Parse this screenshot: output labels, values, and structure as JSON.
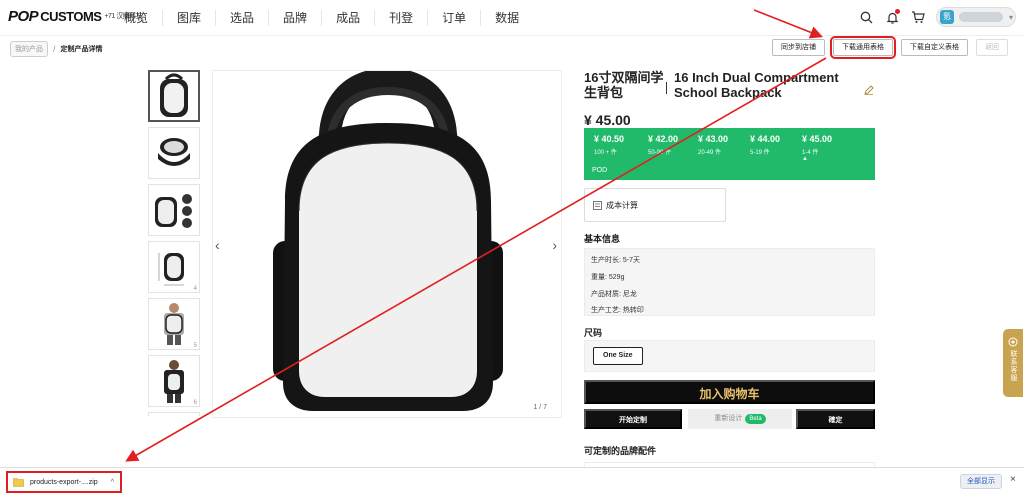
{
  "nav": {
    "logo_pop": "POP",
    "logo_customs": "CUSTOMS",
    "logo_sub": "+71 汉鼎科技",
    "items": [
      {
        "label": "概览"
      },
      {
        "label": "图库"
      },
      {
        "label": "选品"
      },
      {
        "label": "品牌"
      },
      {
        "label": "成品"
      },
      {
        "label": "刊登"
      },
      {
        "label": "订单"
      },
      {
        "label": "数据"
      }
    ],
    "icons": [
      "search-icon",
      "bell-icon",
      "cart-icon"
    ],
    "user_avatar_text": "氪"
  },
  "breadcrumb": {
    "previous": "我的产品",
    "separator": "/",
    "current": "定制产品详情"
  },
  "actions": {
    "sync_store": "同步到店铺",
    "download_common": "下载通用表格",
    "download_custom": "下载自定义表格",
    "back": "返回"
  },
  "gallery": {
    "thumb_numbers": [
      "",
      "",
      "",
      "4",
      "5",
      "6"
    ],
    "pager": "1 / 7"
  },
  "product": {
    "title_cn": "16寸双隔间学生背包",
    "title_en": "16 Inch Dual Compartment School Backpack",
    "price": "¥ 45.00",
    "tiers": [
      {
        "price": "¥ 40.50",
        "qty": "100 + 件"
      },
      {
        "price": "¥ 42.00",
        "qty": "50-99 件"
      },
      {
        "price": "¥ 43.00",
        "qty": "20-49 件"
      },
      {
        "price": "¥ 44.00",
        "qty": "5-19 件"
      },
      {
        "price": "¥ 45.00",
        "qty": "1-4 件"
      }
    ],
    "pod_label": "POD",
    "cost_calc": "成本计算",
    "basic_info_heading": "基本信息",
    "info": [
      {
        "text": "生产时长: 5-7天"
      },
      {
        "text": "重量: 529g"
      },
      {
        "text": "产品材质: 尼龙"
      },
      {
        "text": "生产工艺: 热转印"
      }
    ],
    "size_heading": "尺码",
    "size_option": "One Size",
    "add_to_cart": "加入购物车",
    "start_custom": "开始定制",
    "redesign": "重新设计",
    "beta": "Beta",
    "confirm": "確定",
    "accessories_heading": "可定制的品牌配件"
  },
  "float_tab": {
    "label": "联系客服"
  },
  "download_bar": {
    "file_name": "products-export-....zip",
    "show_all": "全部显示",
    "close": "×"
  },
  "colors": {
    "accent_green": "#21b96a",
    "annotation_red": "#e02020",
    "cart_gold": "#e6c06a",
    "float_tab_gold": "#c9a450"
  }
}
